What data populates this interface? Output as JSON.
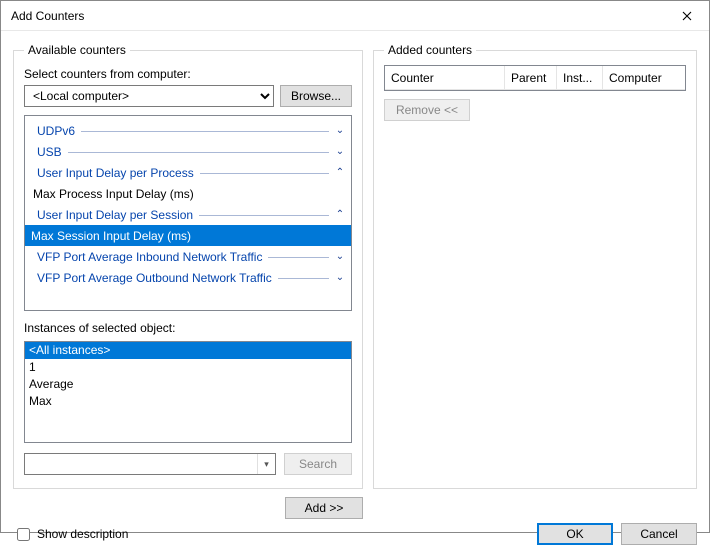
{
  "window": {
    "title": "Add Counters"
  },
  "available": {
    "legend": "Available counters",
    "select_label": "Select counters from computer:",
    "computer_value": "<Local computer>",
    "browse_label": "Browse...",
    "counters": {
      "row0": {
        "label": "UDPv6",
        "expand": "down"
      },
      "row1": {
        "label": "USB",
        "expand": "down"
      },
      "row2": {
        "label": "User Input Delay per Process",
        "expand": "up"
      },
      "row3": {
        "label": "Max Process Input Delay (ms)"
      },
      "row4": {
        "label": "User Input Delay per Session",
        "expand": "up"
      },
      "row5": {
        "label": "Max Session Input Delay (ms)",
        "selected": true
      },
      "row6": {
        "label": "VFP Port Average Inbound Network Traffic",
        "expand": "down"
      },
      "row7": {
        "label": "VFP Port Average Outbound Network Traffic",
        "expand": "down"
      }
    },
    "instances_label": "Instances of selected object:",
    "instances": {
      "i0": {
        "label": "<All instances>",
        "selected": true
      },
      "i1": {
        "label": "1"
      },
      "i2": {
        "label": "Average"
      },
      "i3": {
        "label": "Max"
      }
    },
    "search_label": "Search",
    "add_label": "Add >>"
  },
  "added": {
    "legend": "Added counters",
    "columns": {
      "c0": "Counter",
      "c1": "Parent",
      "c2": "Inst...",
      "c3": "Computer"
    },
    "remove_label": "Remove <<"
  },
  "footer": {
    "show_desc_label": "Show description",
    "ok_label": "OK",
    "cancel_label": "Cancel"
  }
}
